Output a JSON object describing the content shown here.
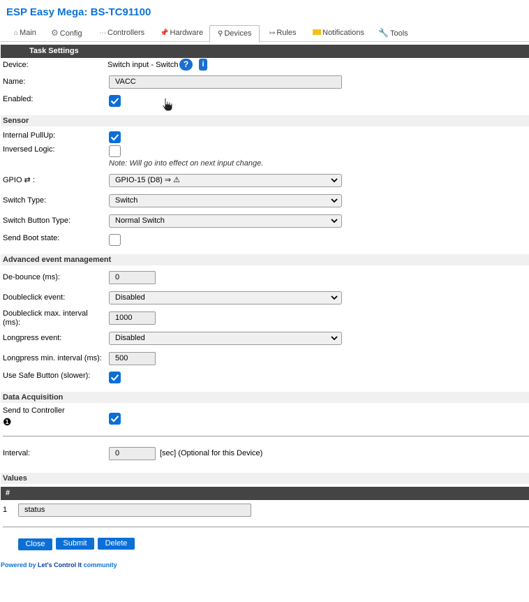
{
  "app": {
    "title": "ESP Easy Mega: BS-TC91100"
  },
  "tabs": [
    {
      "label": "Main",
      "icon": "house-icon"
    },
    {
      "label": "Config",
      "icon": "gear-icon"
    },
    {
      "label": "Controllers",
      "icon": "dots-icon"
    },
    {
      "label": "Hardware",
      "icon": "pushpin-icon"
    },
    {
      "label": "Devices",
      "icon": "plug-icon"
    },
    {
      "label": "Rules",
      "icon": "arrow-icon"
    },
    {
      "label": "Notifications",
      "icon": "envelope-icon"
    },
    {
      "label": "Tools",
      "icon": "wrench-icon"
    }
  ],
  "task": {
    "header": "Task Settings",
    "device_label": "Device:",
    "device_value": "Switch input - Switch",
    "help_glyph": "?",
    "info_glyph": "i",
    "name_label": "Name:",
    "name_value": "VACC",
    "enabled_label": "Enabled:"
  },
  "sensor": {
    "header": "Sensor",
    "pullup_label": "Internal PullUp:",
    "inversed_label": "Inversed Logic:",
    "note": "Note: Will go into effect on next input change.",
    "gpio_label": "GPIO ⇄ :",
    "gpio_value": "GPIO-15 (D8) ⇒ ⚠",
    "switch_type_label": "Switch Type:",
    "switch_type_value": "Switch",
    "button_type_label": "Switch Button Type:",
    "button_type_value": "Normal Switch",
    "boot_label": "Send Boot state:"
  },
  "advanced": {
    "header": "Advanced event management",
    "debounce_label": "De-bounce (ms):",
    "debounce_value": "0",
    "dblclick_label": "Doubleclick event:",
    "dblclick_value": "Disabled",
    "dblclick_interval_label": "Doubleclick max. interval (ms):",
    "dblclick_interval_value": "1000",
    "longpress_label": "Longpress event:",
    "longpress_value": "Disabled",
    "longpress_interval_label": "Longpress min. interval (ms):",
    "longpress_interval_value": "500",
    "safe_label": "Use Safe Button (slower):"
  },
  "acquisition": {
    "header": "Data Acquisition",
    "send_label": "Send to Controller",
    "controller_index": "❶",
    "interval_label": "Interval:",
    "interval_value": "0",
    "interval_suffix": "[sec] (Optional for this Device)"
  },
  "values": {
    "header": "Values",
    "col_hash": "#",
    "row_index": "1",
    "row_name": "status"
  },
  "buttons": {
    "close": "Close",
    "submit": "Submit",
    "delete": "Delete"
  },
  "footer": {
    "prefix": "Powered by ",
    "link": "Let's Control It",
    "suffix": " community"
  },
  "colors": {
    "accent": "#0b6fd6",
    "header_bar": "#444444",
    "section_bg": "#f0f0f0"
  },
  "checkboxes": {
    "enabled": true,
    "pullup": true,
    "inversed": false,
    "boot": false,
    "safe": true,
    "send": true
  }
}
